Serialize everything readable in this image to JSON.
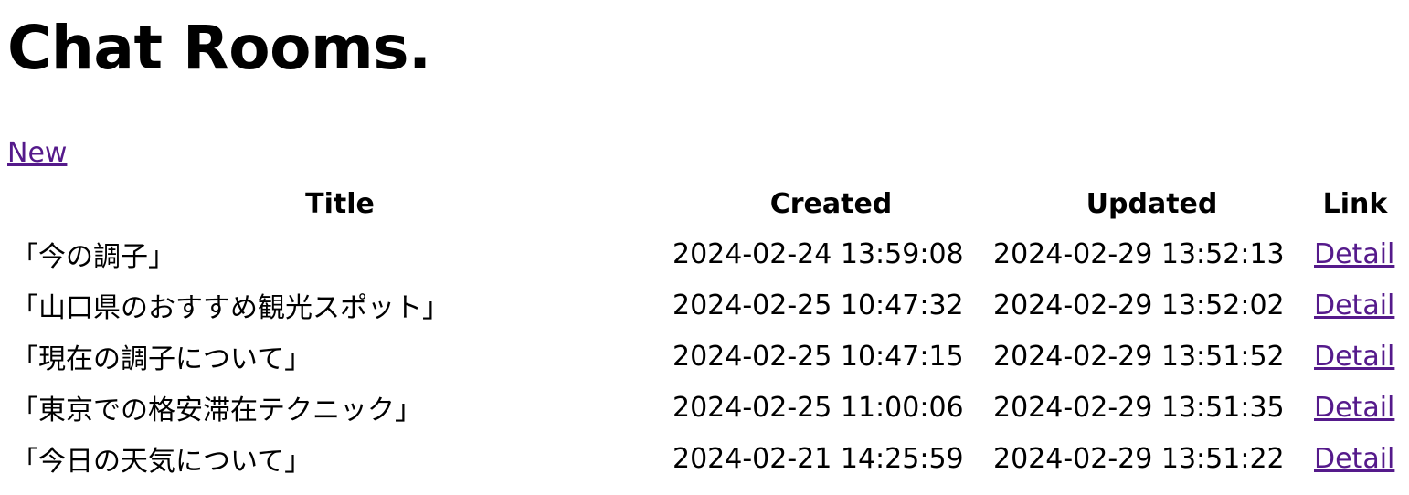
{
  "page": {
    "title": "Chat Rooms.",
    "new_link_label": "New"
  },
  "table": {
    "headers": {
      "title": "Title",
      "created": "Created",
      "updated": "Updated",
      "link": "Link"
    },
    "rows": [
      {
        "title": "「今の調子」",
        "created": "2024-02-24 13:59:08",
        "updated": "2024-02-29 13:52:13",
        "link": "Detail"
      },
      {
        "title": "「山口県のおすすめ観光スポット」",
        "created": "2024-02-25 10:47:32",
        "updated": "2024-02-29 13:52:02",
        "link": "Detail"
      },
      {
        "title": "「現在の調子について」",
        "created": "2024-02-25 10:47:15",
        "updated": "2024-02-29 13:51:52",
        "link": "Detail"
      },
      {
        "title": "「東京での格安滞在テクニック」",
        "created": "2024-02-25 11:00:06",
        "updated": "2024-02-29 13:51:35",
        "link": "Detail"
      },
      {
        "title": "「今日の天気について」",
        "created": "2024-02-21 14:25:59",
        "updated": "2024-02-29 13:51:22",
        "link": "Detail"
      }
    ]
  },
  "colors": {
    "text": "#000000",
    "visited_link": "#551a8b",
    "background": "#ffffff"
  }
}
